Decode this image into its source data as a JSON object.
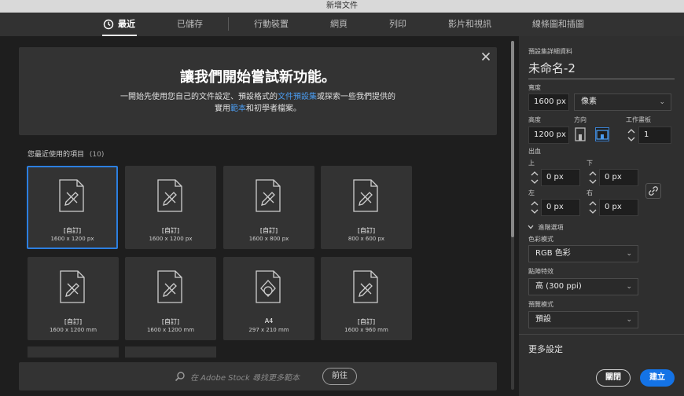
{
  "window": {
    "title": "新增文件"
  },
  "tabs": [
    {
      "label": "最近"
    },
    {
      "label": "已儲存"
    },
    {
      "label": "行動裝置"
    },
    {
      "label": "網頁"
    },
    {
      "label": "列印"
    },
    {
      "label": "影片和視訊"
    },
    {
      "label": "線條圖和插圖"
    }
  ],
  "banner": {
    "title": "讓我們開始嘗試新功能。",
    "line1_a": "一開始先使用您自己的文件設定、預設格式的",
    "line1_link": "文件預設集",
    "line1_b": "或探索一些我們提供的",
    "line2_a": "實用",
    "line2_link": "範本",
    "line2_b": "和初學者檔案。",
    "close_icon": "close-icon"
  },
  "recent": {
    "label": "您最近使用的項目",
    "count": "(10)",
    "items": [
      {
        "name": "[自訂]",
        "size": "1600 x 1200 px"
      },
      {
        "name": "[自訂]",
        "size": "1600 x 1200 px"
      },
      {
        "name": "[自訂]",
        "size": "1600 x 800 px"
      },
      {
        "name": "[自訂]",
        "size": "800 x 600 px"
      },
      {
        "name": "[自訂]",
        "size": "1600 x 1200 mm"
      },
      {
        "name": "[自訂]",
        "size": "1600 x 1200 mm"
      },
      {
        "name": "A4",
        "size": "297 x 210 mm"
      },
      {
        "name": "[自訂]",
        "size": "1600 x 960 mm"
      }
    ]
  },
  "stock": {
    "placeholder": "在 Adobe Stock 尋找更多範本",
    "go_label": "前往"
  },
  "preset": {
    "section_label": "預設集詳細資料",
    "doc_name": "未命名-2",
    "width_label": "寬度",
    "width_value": "1600 px",
    "unit_value": "像素",
    "height_label": "高度",
    "height_value": "1200 px",
    "orientation_label": "方向",
    "artboards_label": "工作畫板",
    "artboards_value": "1",
    "bleed_label": "出血",
    "top_label": "上",
    "bottom_label": "下",
    "left_label": "左",
    "right_label": "右",
    "bleed_top": "0 px",
    "bleed_bottom": "0 px",
    "bleed_left": "0 px",
    "bleed_right": "0 px",
    "advanced_label": "進階選項",
    "color_mode_label": "色彩模式",
    "color_mode_value": "RGB 色彩",
    "raster_label": "點陣特效",
    "raster_value": "高 (300 ppi)",
    "preview_label": "預覽模式",
    "preview_value": "預設",
    "more_settings": "更多設定",
    "close_label": "關閉",
    "create_label": "建立"
  },
  "colors": {
    "accent": "#1473e6",
    "link": "#4b9cf0",
    "selected_border": "#2c7fe0"
  }
}
